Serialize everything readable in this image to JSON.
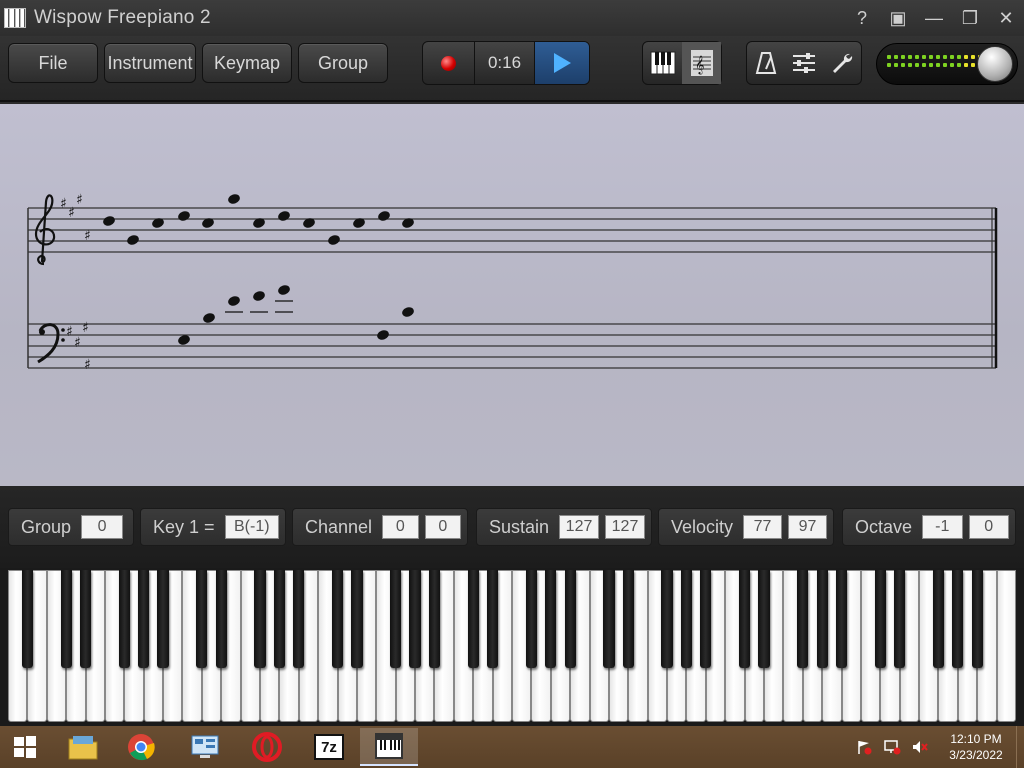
{
  "window": {
    "title": "Wispow Freepiano 2",
    "controls": [
      "?",
      "▣",
      "—",
      "❐",
      "✕"
    ]
  },
  "toolbar": {
    "menus": [
      "File",
      "Instrument",
      "Keymap",
      "Group"
    ],
    "time": "0:16"
  },
  "params": {
    "group": {
      "label": "Group",
      "value": "0"
    },
    "key": {
      "label": "Key  1 =",
      "value": "B(-1)"
    },
    "channel": {
      "label": "Channel",
      "values": [
        "0",
        "0"
      ]
    },
    "sustain": {
      "label": "Sustain",
      "values": [
        "127",
        "127"
      ]
    },
    "velocity": {
      "label": "Velocity",
      "values": [
        "77",
        "97"
      ]
    },
    "octave": {
      "label": "Octave",
      "values": [
        "-1",
        "0"
      ]
    }
  },
  "taskbar": {
    "apps": [
      "start",
      "file-explorer",
      "chrome",
      "control-panel",
      "opera",
      "7zip",
      "freepiano"
    ],
    "seven_zip_label": "7z",
    "clock": {
      "time": "12:10 PM",
      "date": "3/23/2022"
    }
  },
  "meter": {
    "level": 0.85
  },
  "colors": {
    "accent_play": "#4fb2ff",
    "record": "#d40000",
    "led_green": "#7ed321",
    "led_yellow": "#e8e22a"
  }
}
